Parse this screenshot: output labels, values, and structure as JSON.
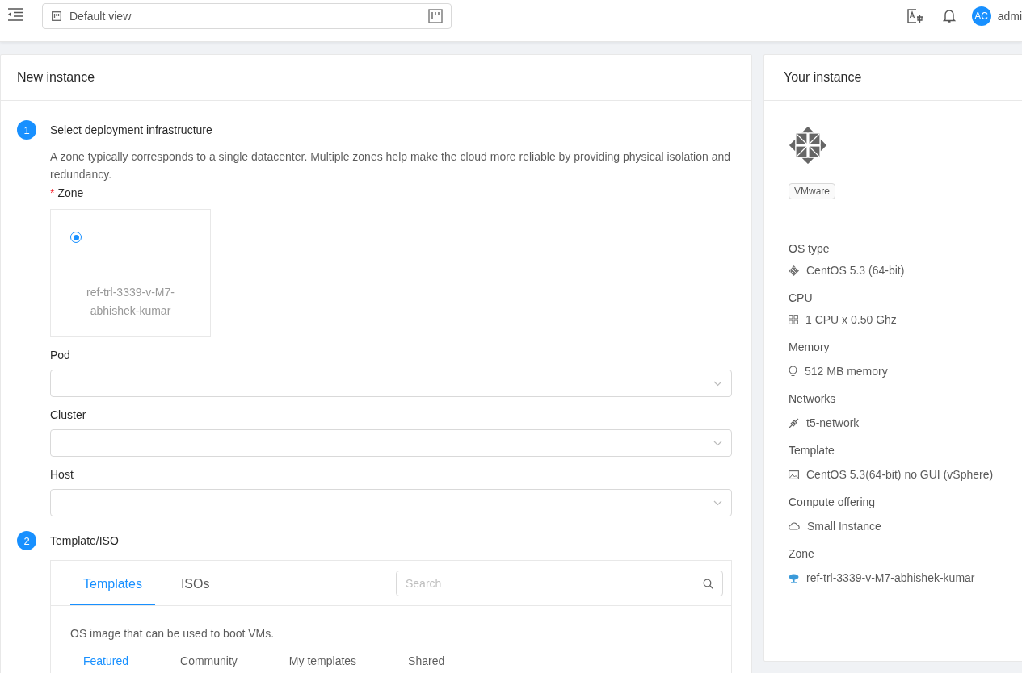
{
  "header": {
    "view_selector": {
      "value": "Default view"
    },
    "user": {
      "initials": "AC",
      "name": "admi"
    }
  },
  "new_instance": {
    "title": "New instance",
    "steps": [
      {
        "number": "1",
        "title": "Select deployment infrastructure",
        "description": "A zone typically corresponds to a single datacenter. Multiple zones help make the cloud more reliable by providing physical isolation and redundancy.",
        "required_mark": "*",
        "zone_label": "Zone",
        "zones": [
          {
            "name": "ref-trl-3339-v-M7-abhishek-kumar",
            "selected": true
          }
        ],
        "selects": [
          {
            "label": "Pod"
          },
          {
            "label": "Cluster"
          },
          {
            "label": "Host"
          }
        ]
      },
      {
        "number": "2",
        "title": "Template/ISO",
        "tabs": [
          {
            "label": "Templates",
            "selected": true
          },
          {
            "label": "ISOs",
            "selected": false
          }
        ],
        "search": {
          "placeholder": "Search"
        },
        "hint": "OS image that can be used to boot VMs.",
        "subtabs": [
          {
            "label": "Featured",
            "selected": true
          },
          {
            "label": "Community",
            "selected": false
          },
          {
            "label": "My templates",
            "selected": false
          },
          {
            "label": "Shared",
            "selected": false
          }
        ]
      }
    ]
  },
  "your_instance": {
    "title": "Your instance",
    "hypervisor": "VMware",
    "details": [
      {
        "label": "OS type",
        "kind": "os",
        "value": "CentOS 5.3 (64-bit)"
      },
      {
        "label": "CPU",
        "kind": "cpu",
        "value": "1 CPU x 0.50 Ghz"
      },
      {
        "label": "Memory",
        "kind": "memory",
        "value": "512 MB memory"
      },
      {
        "label": "Networks",
        "kind": "network",
        "value": "t5-network"
      },
      {
        "label": "Template",
        "kind": "template",
        "value": "CentOS 5.3(64-bit) no GUI (vSphere)"
      },
      {
        "label": "Compute offering",
        "kind": "offering",
        "value": "Small Instance"
      },
      {
        "label": "Zone",
        "kind": "zone",
        "value": "ref-trl-3339-v-M7-abhishek-kumar"
      }
    ]
  }
}
